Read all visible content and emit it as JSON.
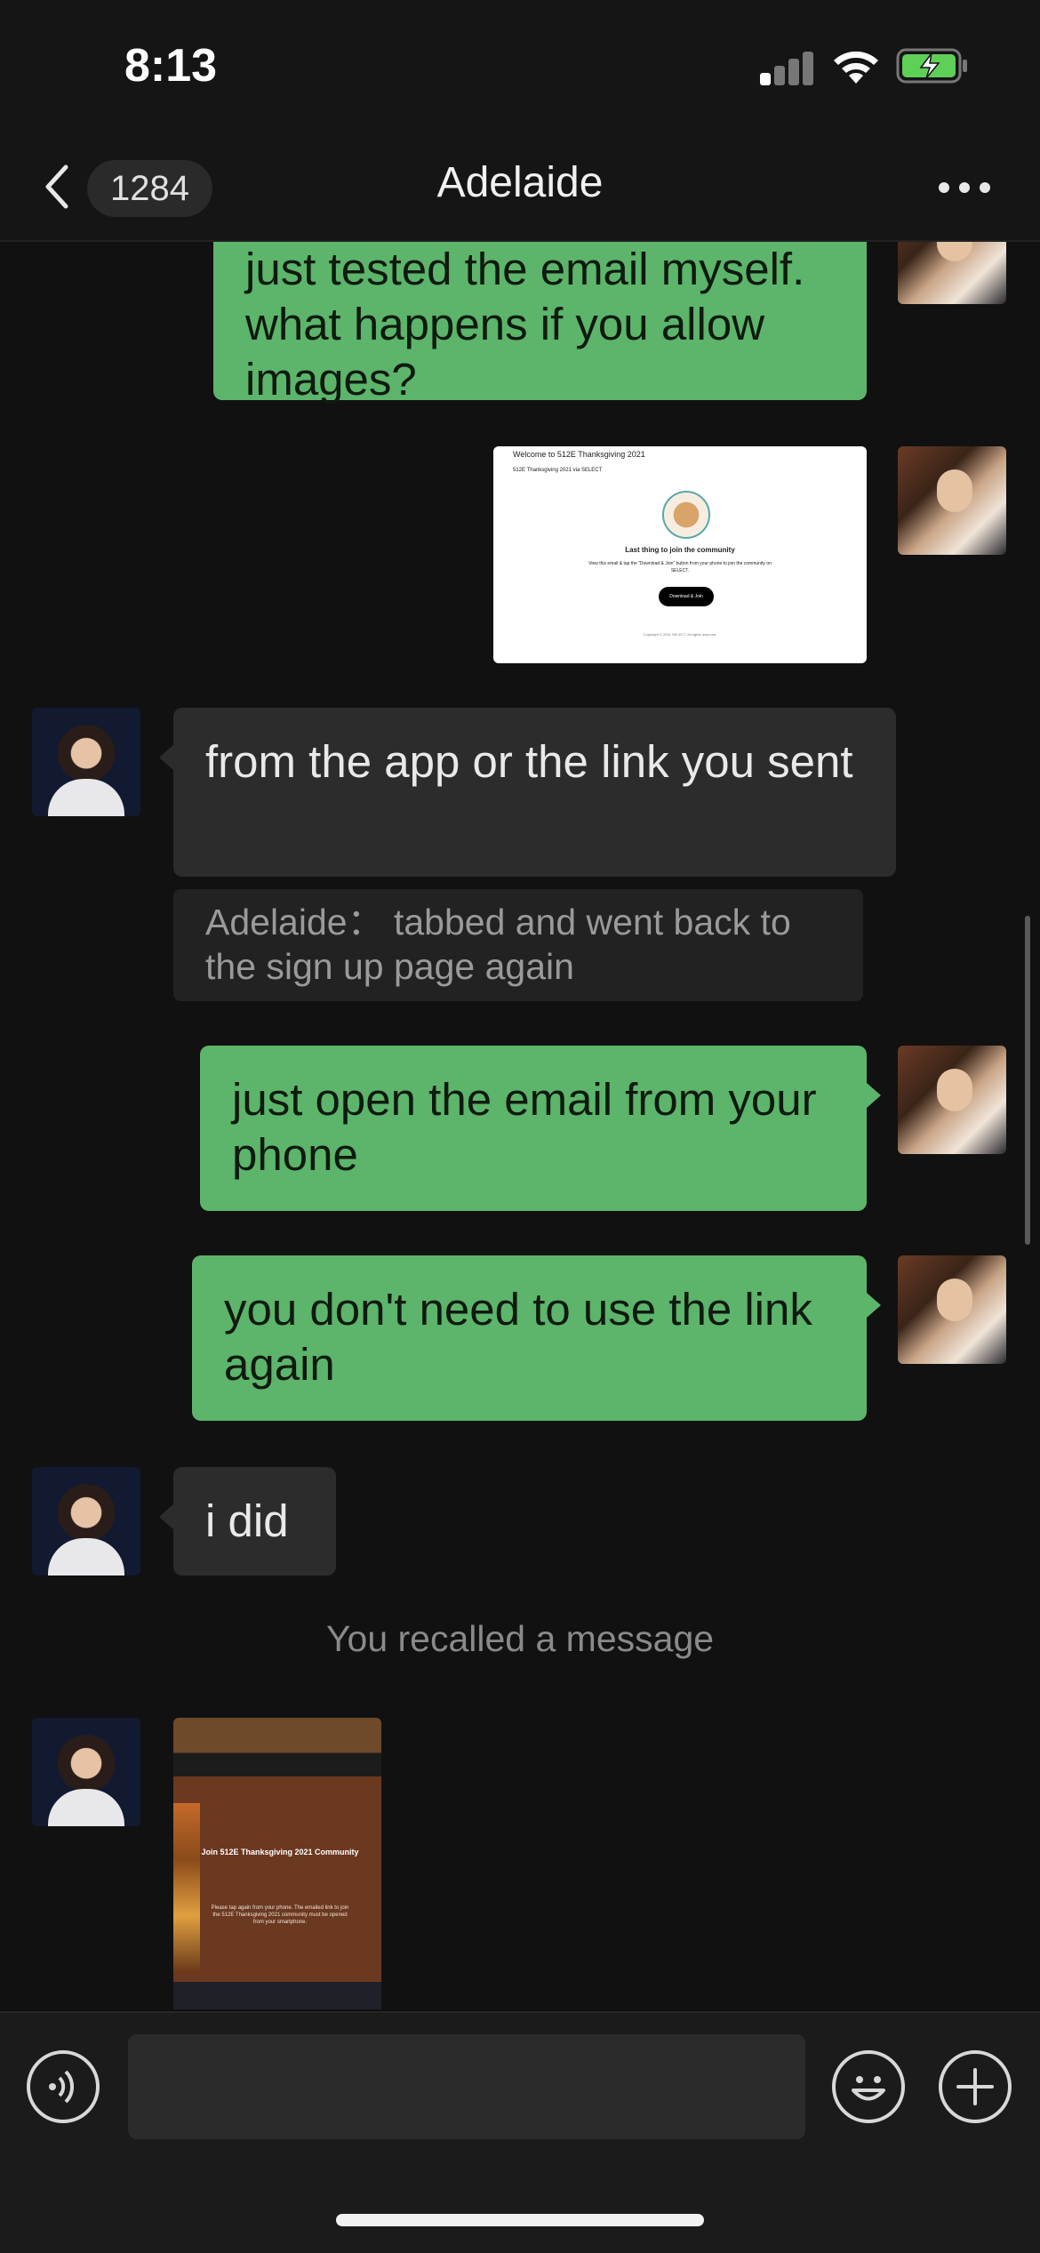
{
  "status_bar": {
    "time": "8:13"
  },
  "nav": {
    "badge_count": "1284",
    "title": "Adelaide"
  },
  "messages": {
    "m1": "just tested the email myself. what happens if you allow images?",
    "m3": "from the app or the link you sent",
    "m3_quote": "Adelaide： tabbed and went back to the sign up page again",
    "m4": "just open the email from your phone",
    "m5": "you don't need to use the link again",
    "m6": "i did",
    "system": "You recalled a message"
  },
  "email_screenshot": {
    "subject": "Welcome to 512E Thanksgiving 2021",
    "from": "512E Thanksgiving 2021 via SELECT",
    "heading": "Last thing to join the community",
    "body": "View this email & tap the \"Download & Join\" button from your phone to join the community on SELECT.",
    "button": "Download & Join",
    "footer": "Copyright © 2021 SELECT. All rights reserved."
  },
  "photo_screenshot": {
    "title": "Join 512E Thanksgiving 2021 Community",
    "body": "Please tap again from your phone. The emailed link to join the 512E Thanksgiving 2021 community must be opened from your smartphone."
  },
  "input": {
    "placeholder": ""
  },
  "colors": {
    "sent_bubble": "#5cb56a",
    "received_bubble": "#2c2c2c",
    "background": "#111111"
  }
}
